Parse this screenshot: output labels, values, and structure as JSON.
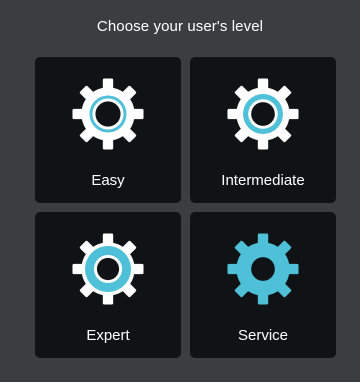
{
  "title": "Choose your user's level",
  "colors": {
    "background": "#3c3d3f",
    "tile": "#101315",
    "accent": "#4ec0d8",
    "gear_white": "#ffffff"
  },
  "levels": [
    {
      "label": "Easy",
      "icon": "gear-outline-icon"
    },
    {
      "label": "Intermediate",
      "icon": "gear-thick-ring-icon"
    },
    {
      "label": "Expert",
      "icon": "gear-filled-ring-icon"
    },
    {
      "label": "Service",
      "icon": "gear-solid-icon"
    }
  ]
}
